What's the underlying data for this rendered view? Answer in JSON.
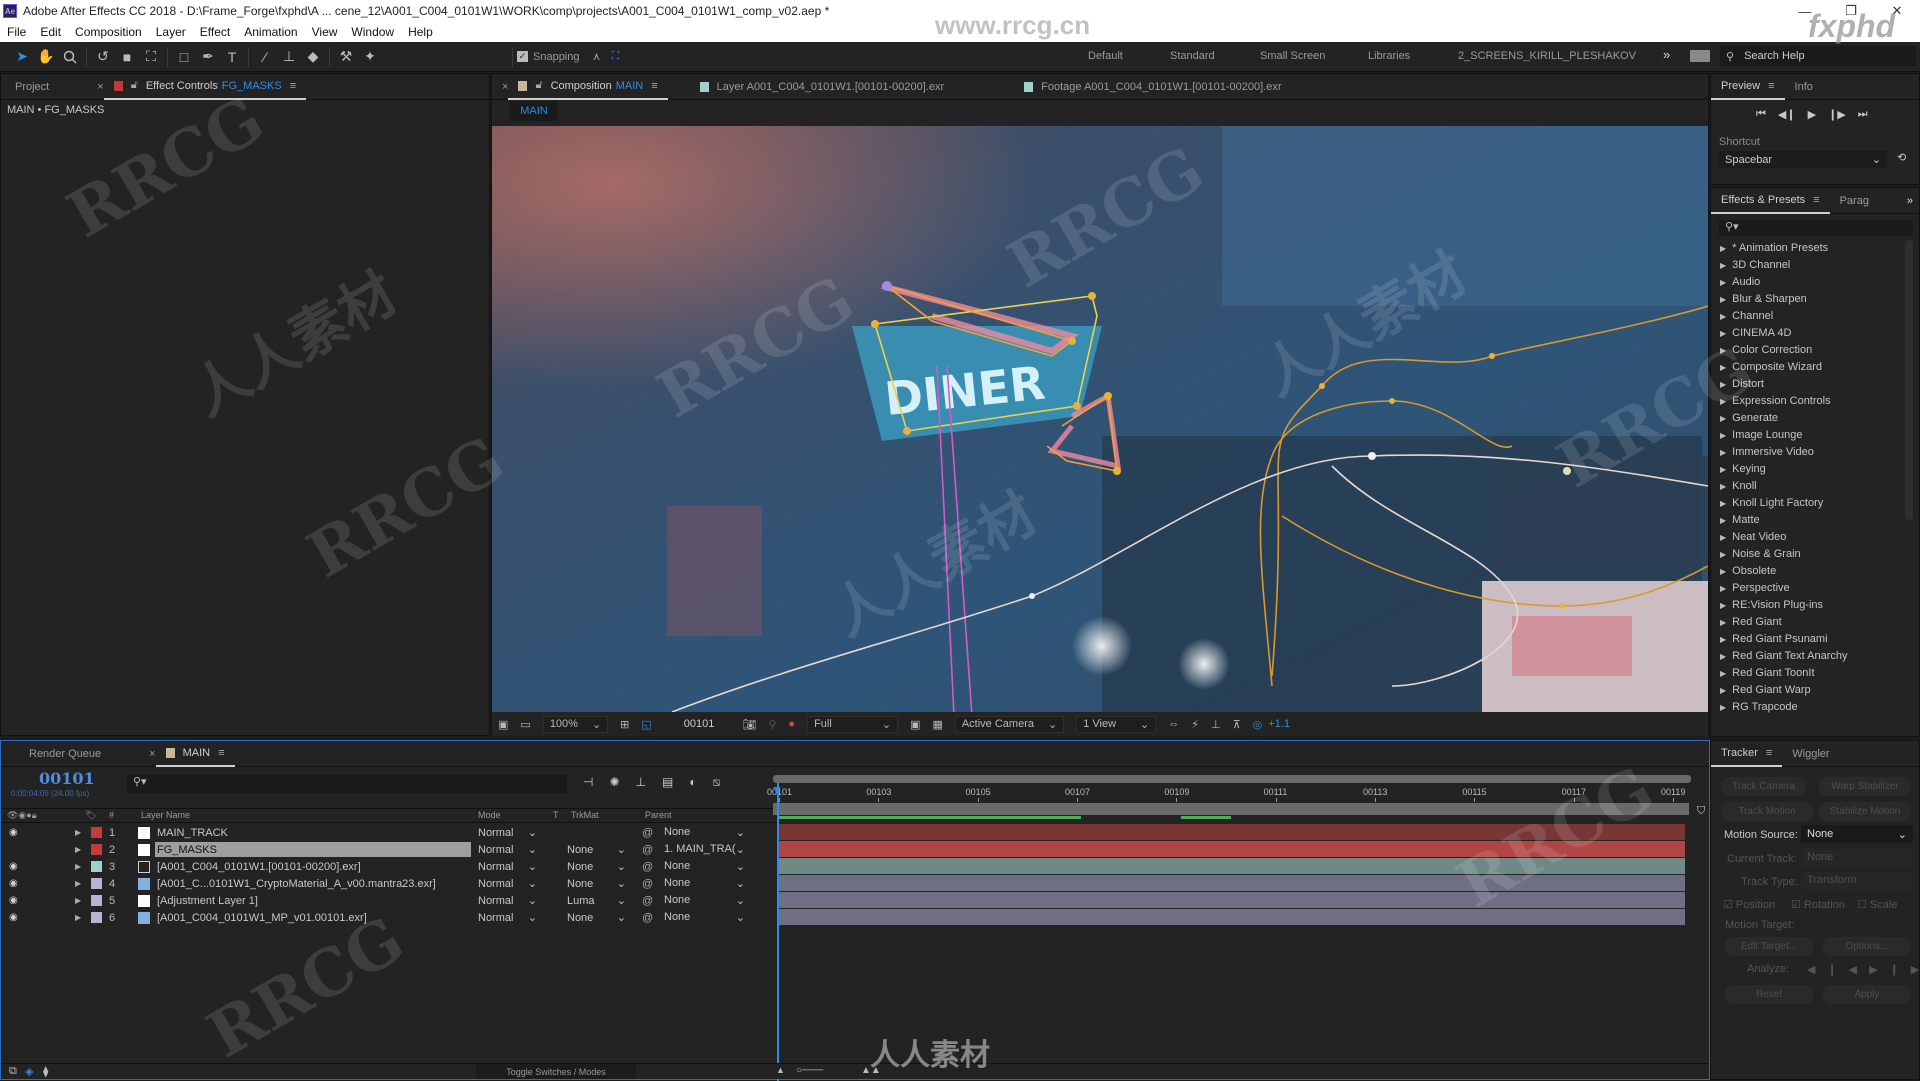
{
  "app": {
    "title": "Adobe After Effects CC 2018 - D:\\Frame_Forge\\fxphd\\A ... cene_12\\A001_C004_0101W1\\WORK\\comp\\projects\\A001_C004_0101W1_comp_v02.aep *",
    "icon_label": "Ae",
    "window_controls": {
      "minimize": "—",
      "maximize": "❐",
      "close": "✕"
    }
  },
  "menu": [
    "File",
    "Edit",
    "Composition",
    "Layer",
    "Effect",
    "Animation",
    "View",
    "Window",
    "Help"
  ],
  "toolbar": {
    "tools": [
      {
        "name": "selection-tool",
        "glyph": "➤",
        "active": true
      },
      {
        "name": "hand-tool",
        "glyph": "✋"
      },
      {
        "name": "zoom-tool",
        "glyph": "🔍"
      },
      {
        "name": "rotation-tool",
        "glyph": "↺"
      },
      {
        "name": "camera-tool",
        "glyph": "■"
      },
      {
        "name": "pan-behind-tool",
        "glyph": "⛶"
      },
      {
        "name": "rectangle-tool",
        "glyph": "□"
      },
      {
        "name": "pen-tool",
        "glyph": "✒"
      },
      {
        "name": "type-tool",
        "glyph": "T"
      },
      {
        "name": "brush-tool",
        "glyph": "∕"
      },
      {
        "name": "clone-stamp-tool",
        "glyph": "⊥"
      },
      {
        "name": "eraser-tool",
        "glyph": "◆"
      },
      {
        "name": "roto-brush-tool",
        "glyph": "⚒"
      },
      {
        "name": "puppet-pin-tool",
        "glyph": "✦"
      }
    ],
    "snapping_label": "Snapping",
    "snapping_checked": true,
    "workspaces": [
      "Default",
      "Standard",
      "Small Screen",
      "Libraries",
      "2_SCREENS_KIRILL_PLESHAKOV"
    ],
    "overflow": "»",
    "search_help_placeholder": "Search Help"
  },
  "left_panel": {
    "tabs": [
      {
        "label": "Project"
      },
      {
        "label": "Effect Controls",
        "target": "FG_MASKS",
        "active": true
      }
    ],
    "breadcrumb": "MAIN • FG_MASKS",
    "swatch": "#c03a3a"
  },
  "comp_panel": {
    "tabs": [
      {
        "label": "Composition",
        "target": "MAIN",
        "active": true,
        "swatch": "#c8b89a"
      },
      {
        "label": "Layer  A001_C004_0101W1.[00101-00200].exr",
        "swatch": "#9fd1c8"
      },
      {
        "label": "Footage  A001_C004_0101W1.[00101-00200].exr",
        "swatch": "#9fd1c8"
      }
    ],
    "sub_tab": "MAIN",
    "viewer_bar": {
      "zoom": "100%",
      "timecode": "00101",
      "resolution": "Full",
      "camera": "Active Camera",
      "views": "1 View",
      "exposure": "+1.1"
    }
  },
  "preview_panel": {
    "tabs": [
      {
        "label": "Preview",
        "active": true
      },
      {
        "label": "Info"
      }
    ],
    "controls": [
      "⏮",
      "◀❙",
      "▶",
      "❙▶",
      "⏭"
    ],
    "shortcut_label": "Shortcut",
    "shortcut_value": "Spacebar"
  },
  "effects_panel": {
    "tabs": [
      {
        "label": "Effects & Presets",
        "active": true
      },
      {
        "label": "Parag"
      }
    ],
    "search_placeholder": "",
    "items": [
      "* Animation Presets",
      "3D Channel",
      "Audio",
      "Blur & Sharpen",
      "Channel",
      "CINEMA 4D",
      "Color Correction",
      "Composite Wizard",
      "Distort",
      "Expression Controls",
      "Generate",
      "Image Lounge",
      "Immersive Video",
      "Keying",
      "Knoll",
      "Knoll Light Factory",
      "Matte",
      "Neat Video",
      "Noise & Grain",
      "Obsolete",
      "Perspective",
      "RE:Vision Plug-ins",
      "Red Giant",
      "Red Giant Psunami",
      "Red Giant Text Anarchy",
      "Red Giant ToonIt",
      "Red Giant Warp",
      "RG Trapcode"
    ]
  },
  "tracker_panel": {
    "tabs": [
      {
        "label": "Tracker",
        "active": true
      },
      {
        "label": "Wiggler"
      }
    ],
    "buttons": {
      "track_camera": "Track Camera",
      "warp_stabilizer": "Warp Stabilizer",
      "track_motion": "Track Motion",
      "stabilize_motion": "Stabilize Motion",
      "edit_target": "Edit Target...",
      "options": "Options...",
      "reset": "Reset",
      "apply": "Apply"
    },
    "motion_source_label": "Motion Source:",
    "motion_source_value": "None",
    "current_track_label": "Current Track:",
    "current_track_value": "None",
    "track_type_label": "Track Type:",
    "track_type_value": "Transform",
    "position_label": "Position",
    "position_checked": true,
    "rotation_label": "Rotation",
    "rotation_checked": true,
    "scale_label": "Scale",
    "scale_checked": false,
    "motion_target_label": "Motion Target:",
    "analyze_label": "Analyze:"
  },
  "timeline": {
    "tabs": [
      {
        "label": "Render Queue"
      },
      {
        "label": "MAIN",
        "active": true,
        "swatch": "#c8b89a"
      }
    ],
    "current_time": "00101",
    "current_time_sub": "0:00:04:05 (24.00 fps)",
    "columns": {
      "layer_name": "Layer Name",
      "mode": "Mode",
      "t": "T",
      "trkmat": "TrkMat",
      "parent": "Parent",
      "num": "#"
    },
    "ruler_ticks": [
      "00101",
      "00103",
      "00105",
      "00107",
      "00109",
      "00111",
      "00113",
      "00115",
      "00117",
      "00119"
    ],
    "layers": [
      {
        "num": "1",
        "name": "MAIN_TRACK",
        "label_color": "#c83a3a",
        "mode": "Normal",
        "trkmat": "",
        "parent": "None",
        "visible": true,
        "bar_color": "#7a3535",
        "icon": "solid"
      },
      {
        "num": "2",
        "name": "FG_MASKS",
        "label_color": "#c83a3a",
        "mode": "Normal",
        "trkmat": "None",
        "parent": "1. MAIN_TRA(",
        "visible": false,
        "selected": true,
        "bar_color": "#b04545",
        "icon": "solid"
      },
      {
        "num": "3",
        "name": "[A001_C004_0101W1.[00101-00200].exr]",
        "label_color": "#9fd1c8",
        "mode": "Normal",
        "trkmat": "None",
        "parent": "None",
        "visible": true,
        "bar_color": "#6f8a84",
        "icon": "sequence"
      },
      {
        "num": "4",
        "name": "[A001_C...0101W1_CryptoMaterial_A_v00.mantra23.exr]",
        "label_color": "#b9b3d6",
        "mode": "Normal",
        "trkmat": "None",
        "parent": "None",
        "visible": true,
        "bar_color": "#6e6f84",
        "icon": "file"
      },
      {
        "num": "5",
        "name": "[Adjustment Layer 1]",
        "label_color": "#b9b3d6",
        "mode": "Normal",
        "trkmat": "Luma",
        "parent": "None",
        "visible": true,
        "bar_color": "#6e6f84",
        "icon": "solid"
      },
      {
        "num": "6",
        "name": "[A001_C004_0101W1_MP_v01.00101.exr]",
        "label_color": "#b9b3d6",
        "mode": "Normal",
        "trkmat": "None",
        "parent": "None",
        "visible": true,
        "bar_color": "#6e6f84",
        "icon": "file"
      }
    ],
    "toggle_label": "Toggle Switches / Modes"
  },
  "overlays": {
    "watermark_main": "RRCG",
    "watermark_cn": "人人素材",
    "logo_url_text": "www.rrcg.cn",
    "fxphd": "fxphd"
  }
}
